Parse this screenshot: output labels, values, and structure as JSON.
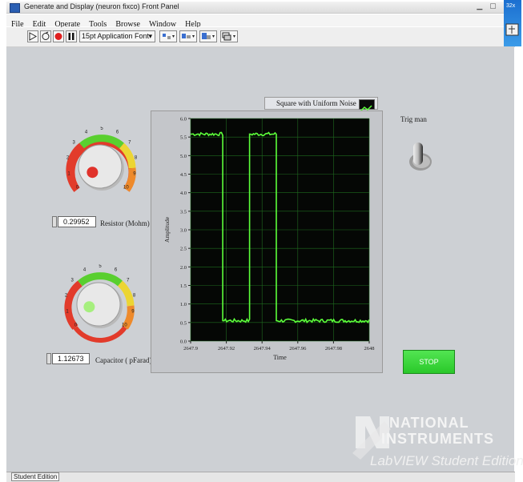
{
  "window": {
    "title": "Generate and Display (neuron fixco) Front Panel",
    "thumb_text": "32x"
  },
  "menu": [
    "File",
    "Edit",
    "Operate",
    "Tools",
    "Browse",
    "Window",
    "Help"
  ],
  "toolbar": {
    "font_select": "15pt Application Font"
  },
  "controls": {
    "resistor": {
      "label": "Resistor (Mohm)",
      "value": "0.29952",
      "knob_fraction": 0.03
    },
    "capacitor": {
      "label": "Capacitor ( pFarad)",
      "value": "1.12673",
      "knob_fraction": 0.11
    },
    "knob_scale": [
      "0",
      "1",
      "2",
      "3",
      "4",
      "5",
      "6",
      "7",
      "8",
      "9",
      "10"
    ],
    "toggle": {
      "label": "Trig man"
    },
    "stop": {
      "label": "STOP"
    }
  },
  "graph": {
    "legend": "Square with Uniform Noise",
    "xlabel": "Time",
    "ylabel": "Amplitude"
  },
  "branding": {
    "line1": "NATIONAL",
    "line2": "INSTRUMENTS",
    "line3": "LabVIEW Student Edition"
  },
  "status": {
    "text": "Student Edition"
  },
  "chart_data": {
    "type": "line",
    "xlabel": "Time",
    "ylabel": "Amplitude",
    "xlim": [
      2647.9,
      2648.0
    ],
    "ylim": [
      0.0,
      6.0
    ],
    "x_ticks": [
      "2647.9",
      "2647.92",
      "2647.94",
      "2647.96",
      "2647.98",
      "2648"
    ],
    "y_ticks": [
      "0.0",
      "0.5",
      "1.0",
      "1.5",
      "2.0",
      "2.5",
      "3.0",
      "3.5",
      "4.0",
      "4.5",
      "5.0",
      "5.5",
      "6.0"
    ],
    "grid": true,
    "colors": {
      "line": "#5cff3a",
      "plot_bg": "#050705",
      "grid": "#1f6b1f"
    },
    "series": [
      {
        "name": "Square with Uniform Noise",
        "x": [
          2647.9,
          2647.918,
          2647.918,
          2647.933,
          2647.933,
          2647.948,
          2647.948,
          2647.963,
          2647.963,
          2648.0
        ],
        "y": [
          5.58,
          5.58,
          0.55,
          0.55,
          5.58,
          5.58,
          0.55,
          0.55,
          0.55,
          0.55
        ]
      }
    ]
  }
}
